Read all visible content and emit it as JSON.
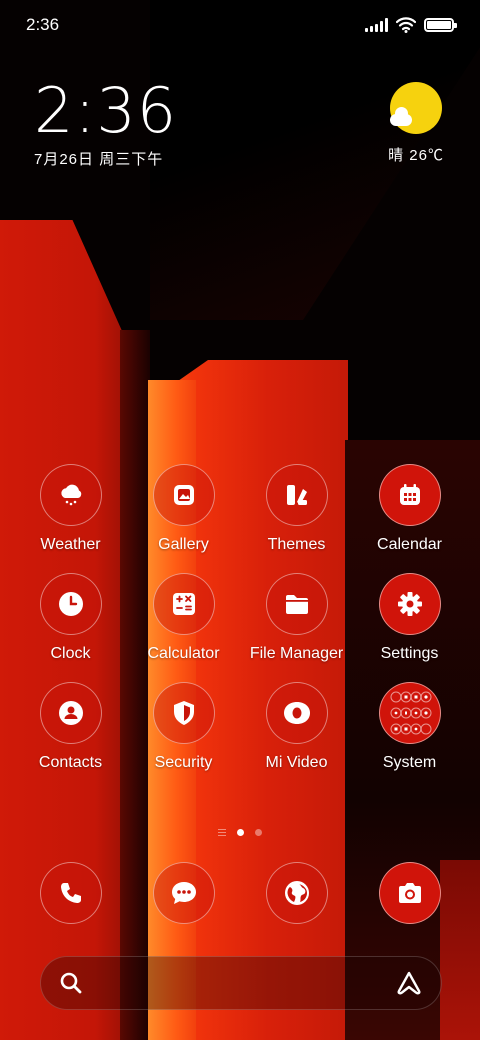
{
  "status_bar": {
    "time": "2:36"
  },
  "clock_widget": {
    "time": "2:36",
    "date": "7月26日 周三下午"
  },
  "weather_widget": {
    "text": "晴 26℃",
    "icon": "sunny-partly-cloudy-icon"
  },
  "apps": [
    {
      "label": "Weather",
      "icon": "weather-icon",
      "style": "outline"
    },
    {
      "label": "Gallery",
      "icon": "gallery-icon",
      "style": "outline"
    },
    {
      "label": "Themes",
      "icon": "themes-icon",
      "style": "outline"
    },
    {
      "label": "Calendar",
      "icon": "calendar-icon",
      "style": "solid"
    },
    {
      "label": "Clock",
      "icon": "clock-icon",
      "style": "outline"
    },
    {
      "label": "Calculator",
      "icon": "calculator-icon",
      "style": "outline"
    },
    {
      "label": "File Manager",
      "icon": "folder-icon",
      "style": "outline"
    },
    {
      "label": "Settings",
      "icon": "gear-icon",
      "style": "solid"
    },
    {
      "label": "Contacts",
      "icon": "contacts-icon",
      "style": "outline"
    },
    {
      "label": "Security",
      "icon": "shield-icon",
      "style": "outline"
    },
    {
      "label": "Mi Video",
      "icon": "video-icon",
      "style": "outline"
    },
    {
      "label": "System",
      "icon": "folder-grid-icon",
      "style": "solid"
    }
  ],
  "page_indicator": {
    "pages": 2,
    "active": 1
  },
  "dock": [
    {
      "icon": "phone-icon"
    },
    {
      "icon": "messages-icon"
    },
    {
      "icon": "browser-globe-icon"
    },
    {
      "icon": "camera-icon"
    }
  ],
  "search_bar": {
    "left_icon": "search-icon",
    "right_icon": "assistant-icon"
  },
  "colors": {
    "accent_red": "#d0140a",
    "sun_yellow": "#f6d20e"
  }
}
